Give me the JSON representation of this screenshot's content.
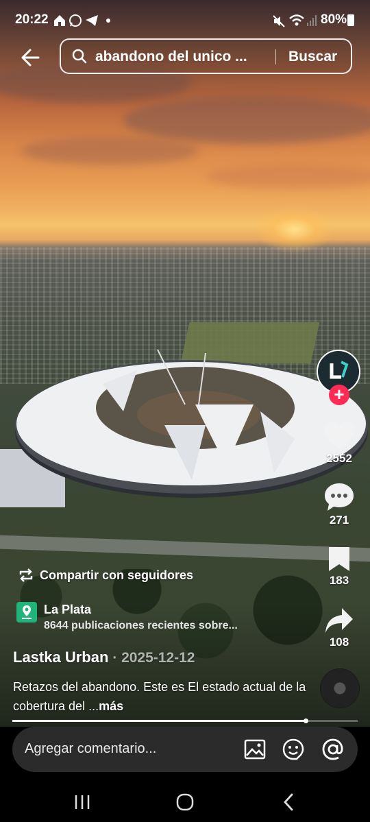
{
  "status_bar": {
    "time": "20:22",
    "battery": "80%",
    "icons": [
      "home-icon",
      "whatsapp-icon",
      "telegram-icon",
      "dot-icon",
      "mute-icon",
      "wifi-icon",
      "signal-icon",
      "battery-icon"
    ]
  },
  "search": {
    "query": "abandono del unico ...",
    "button": "Buscar"
  },
  "actions": {
    "likes": "2552",
    "comments": "271",
    "saves": "183",
    "shares": "108",
    "follow_symbol": "+"
  },
  "share": {
    "label": "Compartir con seguidores"
  },
  "place": {
    "name": "La Plata",
    "subtitle": "8644 publicaciones recientes sobre..."
  },
  "post": {
    "author": "Lastka Urban",
    "separator": " · ",
    "date": "2025-12-12",
    "caption": "Retazos del abandono. Este es El estado actual de la cobertura del ...",
    "more": "más",
    "progress": 0.85
  },
  "comment": {
    "placeholder": "Agregar comentario..."
  },
  "colors": {
    "accent": "#fe2c55",
    "place_badge": "#21b47a",
    "comment_bg": "#2b2b2b"
  }
}
